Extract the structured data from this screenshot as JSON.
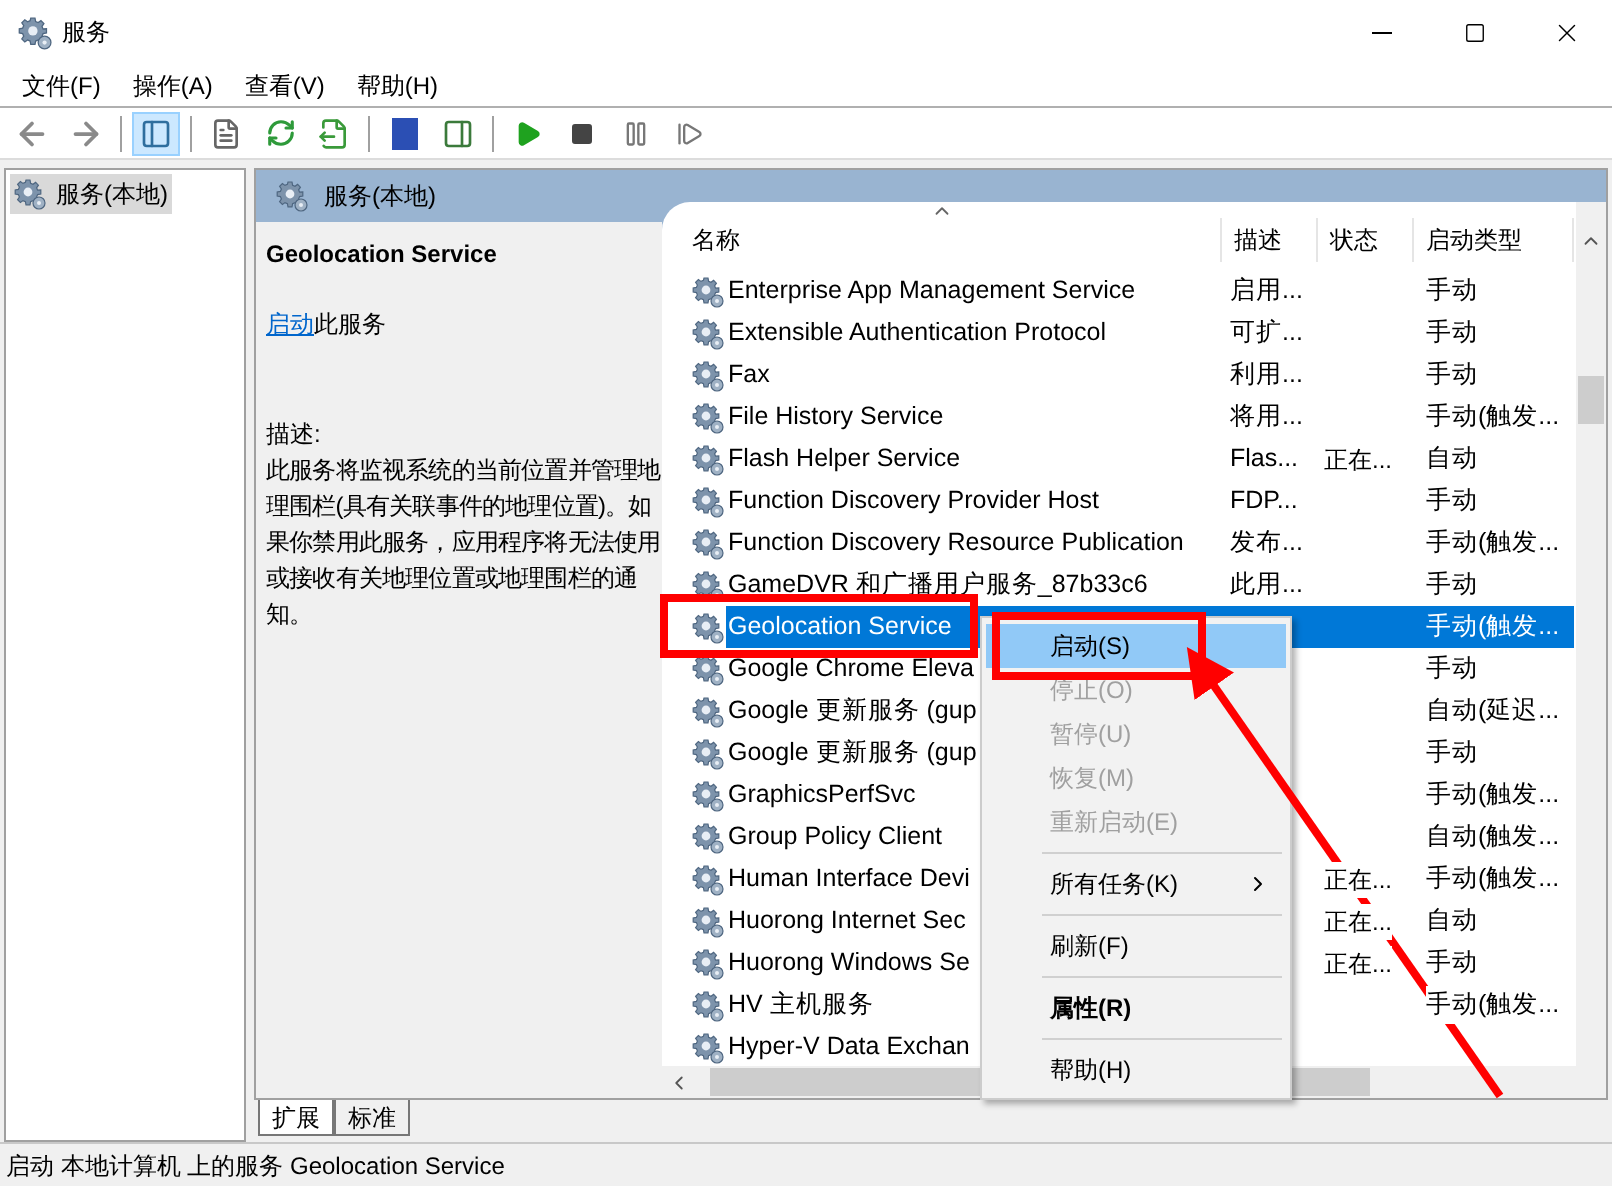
{
  "window": {
    "title": "服务"
  },
  "menu": [
    "文件(F)",
    "操作(A)",
    "查看(V)",
    "帮助(H)"
  ],
  "toolbar": {
    "console_tree_pressed": true
  },
  "tree": {
    "items": [
      {
        "label": "服务(本地)",
        "selected": true
      }
    ]
  },
  "pane_header": "服务(本地)",
  "detail": {
    "title": "Geolocation Service",
    "action_link": "启动",
    "action_rest": "此服务",
    "description_label": "描述:",
    "description": "此服务将监视系统的当前位置并管理地理围栏(具有关联事件的地理位置)。如果你禁用此服务，应用程序将无法使用或接收有关地理位置或地理围栏的通知。"
  },
  "table": {
    "columns": [
      {
        "label": "名称"
      },
      {
        "label": "描述"
      },
      {
        "label": "状态"
      },
      {
        "label": "启动类型"
      }
    ],
    "rows": [
      {
        "name": "Enterprise App Management Service",
        "description": "启用...",
        "startup": "手动",
        "selected": false
      },
      {
        "name": "Extensible Authentication Protocol",
        "description": "可扩...",
        "startup": "手动",
        "selected": false
      },
      {
        "name": "Fax",
        "description": "利用...",
        "startup": "手动",
        "selected": false
      },
      {
        "name": "File History Service",
        "description": "将用...",
        "startup": "手动(触发...",
        "selected": false
      },
      {
        "name": "Flash Helper Service",
        "description": "Flas...",
        "status": "正在...",
        "startup": "自动",
        "selected": false
      },
      {
        "name": "Function Discovery Provider Host",
        "description": "FDP...",
        "startup": "手动",
        "selected": false
      },
      {
        "name": "Function Discovery Resource Publication",
        "description": "发布...",
        "startup": "手动(触发...",
        "selected": false
      },
      {
        "name": "GameDVR 和广播用户服务_87b33c6",
        "description": "此用...",
        "startup": "手动",
        "selected": false
      },
      {
        "name": "Geolocation Service",
        "startup": "手动(触发...",
        "selected": true
      },
      {
        "name": "Google Chrome Eleva",
        "startup": "手动",
        "selected": false
      },
      {
        "name": "Google 更新服务 (gup",
        "startup": "自动(延迟...",
        "selected": false
      },
      {
        "name": "Google 更新服务 (gup",
        "startup": "手动",
        "selected": false
      },
      {
        "name": "GraphicsPerfSvc",
        "startup": "手动(触发...",
        "selected": false
      },
      {
        "name": "Group Policy Client",
        "startup": "自动(触发...",
        "selected": false
      },
      {
        "name": "Human Interface Devi",
        "status": "正在...",
        "startup": "手动(触发...",
        "selected": false
      },
      {
        "name": "Huorong Internet Sec",
        "status": "正在...",
        "startup": "自动",
        "selected": false
      },
      {
        "name": "Huorong Windows Se",
        "status": "正在...",
        "startup": "手动",
        "selected": false
      },
      {
        "name": "HV 主机服务",
        "startup": "手动(触发...",
        "selected": false
      },
      {
        "name": "Hyper-V Data Exchan",
        "selected": false
      }
    ]
  },
  "context_menu": {
    "items": [
      {
        "kind": "command",
        "label": "启动(S)",
        "disabled": false,
        "selected": true
      },
      {
        "kind": "command",
        "label": "停止(O)",
        "disabled": true,
        "selected": false
      },
      {
        "kind": "command",
        "label": "暂停(U)",
        "disabled": true,
        "selected": false
      },
      {
        "kind": "command",
        "label": "恢复(M)",
        "disabled": true,
        "selected": false
      },
      {
        "kind": "command",
        "label": "重新启动(E)",
        "disabled": true,
        "selected": false
      },
      {
        "kind": "separator"
      },
      {
        "kind": "submenu",
        "label": "所有任务(K)",
        "disabled": false,
        "selected": false
      },
      {
        "kind": "separator"
      },
      {
        "kind": "command",
        "label": "刷新(F)",
        "disabled": false,
        "selected": false
      },
      {
        "kind": "separator"
      },
      {
        "kind": "default",
        "label": "属性(R)",
        "disabled": false,
        "selected": false
      },
      {
        "kind": "separator"
      },
      {
        "kind": "command",
        "label": "帮助(H)",
        "disabled": false,
        "selected": false
      }
    ]
  },
  "view_tabs": [
    {
      "label": "扩展",
      "selected": true
    },
    {
      "label": "标准",
      "selected": false
    }
  ],
  "status_bar": "启动 本地计算机 上的服务 Geolocation Service"
}
